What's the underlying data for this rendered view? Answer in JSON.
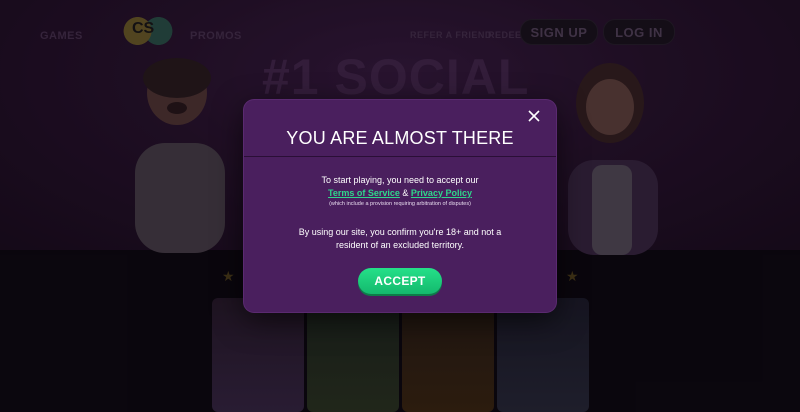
{
  "background": {
    "nav_items": [
      "GAMES",
      "PROMOS",
      "REFER A FRIEND",
      "REDEEM"
    ],
    "logo_text": "CS",
    "sign_up_label": "SIGN UP",
    "log_in_label": "LOG IN",
    "hero_title": "#1 SOCIAL"
  },
  "modal": {
    "title": "YOU ARE ALMOST THERE",
    "intro": "To start playing, you need to accept our",
    "terms_link": "Terms of Service",
    "and_text": " & ",
    "privacy_link": "Privacy Policy",
    "arbitration_note": "(which include a provision requiring arbitration of disputes)",
    "confirm_text": "By using our site, you confirm you're 18+ and not a resident of an excluded territory.",
    "accept_label": "ACCEPT",
    "close_icon": "close-icon"
  },
  "colors": {
    "modal_bg": "#4a1f5e",
    "accept_green": "#1ccf7c",
    "link_green": "#2fd68b"
  }
}
